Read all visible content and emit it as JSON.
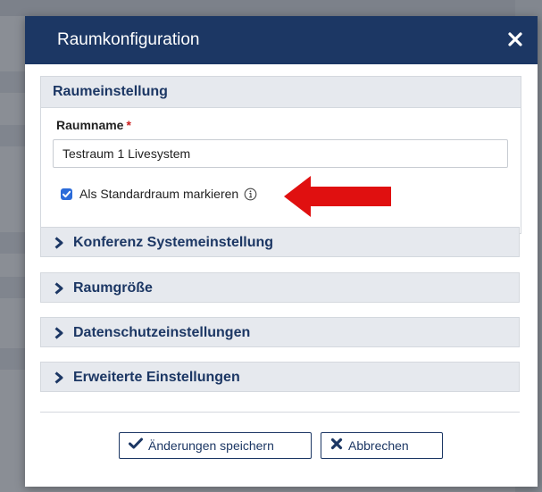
{
  "modal": {
    "title": "Raumkonfiguration",
    "close_icon": "close-icon"
  },
  "room_settings": {
    "title": "Raumeinstellung",
    "name_label": "Raumname",
    "required_marker": "*",
    "name_value": "Testraum 1 Livesystem",
    "default_checkbox_label": "Als Standardraum markieren",
    "default_checked": true,
    "info_icon": "info-icon"
  },
  "accordion": [
    {
      "label": "Konferenz Systemeinstellung"
    },
    {
      "label": "Raumgröße"
    },
    {
      "label": "Datenschutzeinstellungen"
    },
    {
      "label": "Erweiterte Einstellungen"
    }
  ],
  "footer": {
    "save_label": "Änderungen speichern",
    "cancel_label": "Abbrechen"
  },
  "colors": {
    "header_bg": "#1c3764",
    "accent_blue": "#2b6bd9",
    "arrow_red": "#e01010",
    "required_red": "#cc1f1f"
  }
}
